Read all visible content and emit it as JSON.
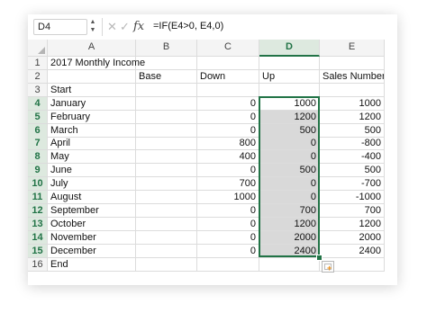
{
  "formula_bar": {
    "name_box": "D4",
    "cancel_icon": "✕",
    "enter_icon": "✓",
    "fx_label": "fx",
    "formula": "=IF(E4>0, E4,0)"
  },
  "columns": [
    "A",
    "B",
    "C",
    "D",
    "E"
  ],
  "selected_column": "D",
  "rows": [
    {
      "num": "1",
      "A": "2017 Monthly Income",
      "B": "",
      "C": "",
      "D": "",
      "E": ""
    },
    {
      "num": "2",
      "A": "",
      "B": "Base",
      "C": "Down",
      "D": "Up",
      "E": "Sales Number"
    },
    {
      "num": "3",
      "A": "Start",
      "B": "",
      "C": "",
      "D": "",
      "E": ""
    },
    {
      "num": "4",
      "A": "January",
      "B": "",
      "C": "0",
      "D": "1000",
      "E": "1000"
    },
    {
      "num": "5",
      "A": "February",
      "B": "",
      "C": "0",
      "D": "1200",
      "E": "1200"
    },
    {
      "num": "6",
      "A": "March",
      "B": "",
      "C": "0",
      "D": "500",
      "E": "500"
    },
    {
      "num": "7",
      "A": "April",
      "B": "",
      "C": "800",
      "D": "0",
      "E": "-800"
    },
    {
      "num": "8",
      "A": "May",
      "B": "",
      "C": "400",
      "D": "0",
      "E": "-400"
    },
    {
      "num": "9",
      "A": "June",
      "B": "",
      "C": "0",
      "D": "500",
      "E": "500"
    },
    {
      "num": "10",
      "A": "July",
      "B": "",
      "C": "700",
      "D": "0",
      "E": "-700"
    },
    {
      "num": "11",
      "A": "August",
      "B": "",
      "C": "1000",
      "D": "0",
      "E": "-1000"
    },
    {
      "num": "12",
      "A": "September",
      "B": "",
      "C": "0",
      "D": "700",
      "E": "700"
    },
    {
      "num": "13",
      "A": "October",
      "B": "",
      "C": "0",
      "D": "1200",
      "E": "1200"
    },
    {
      "num": "14",
      "A": "November",
      "B": "",
      "C": "0",
      "D": "2000",
      "E": "2000"
    },
    {
      "num": "15",
      "A": "December",
      "B": "",
      "C": "0",
      "D": "2400",
      "E": "2400"
    },
    {
      "num": "16",
      "A": "End",
      "B": "",
      "C": "",
      "D": "",
      "E": ""
    }
  ],
  "colors": {
    "selection_accent": "#217346",
    "selection_fill": "#d9d9d9",
    "quick_analysis_plus": "#e8880b"
  }
}
